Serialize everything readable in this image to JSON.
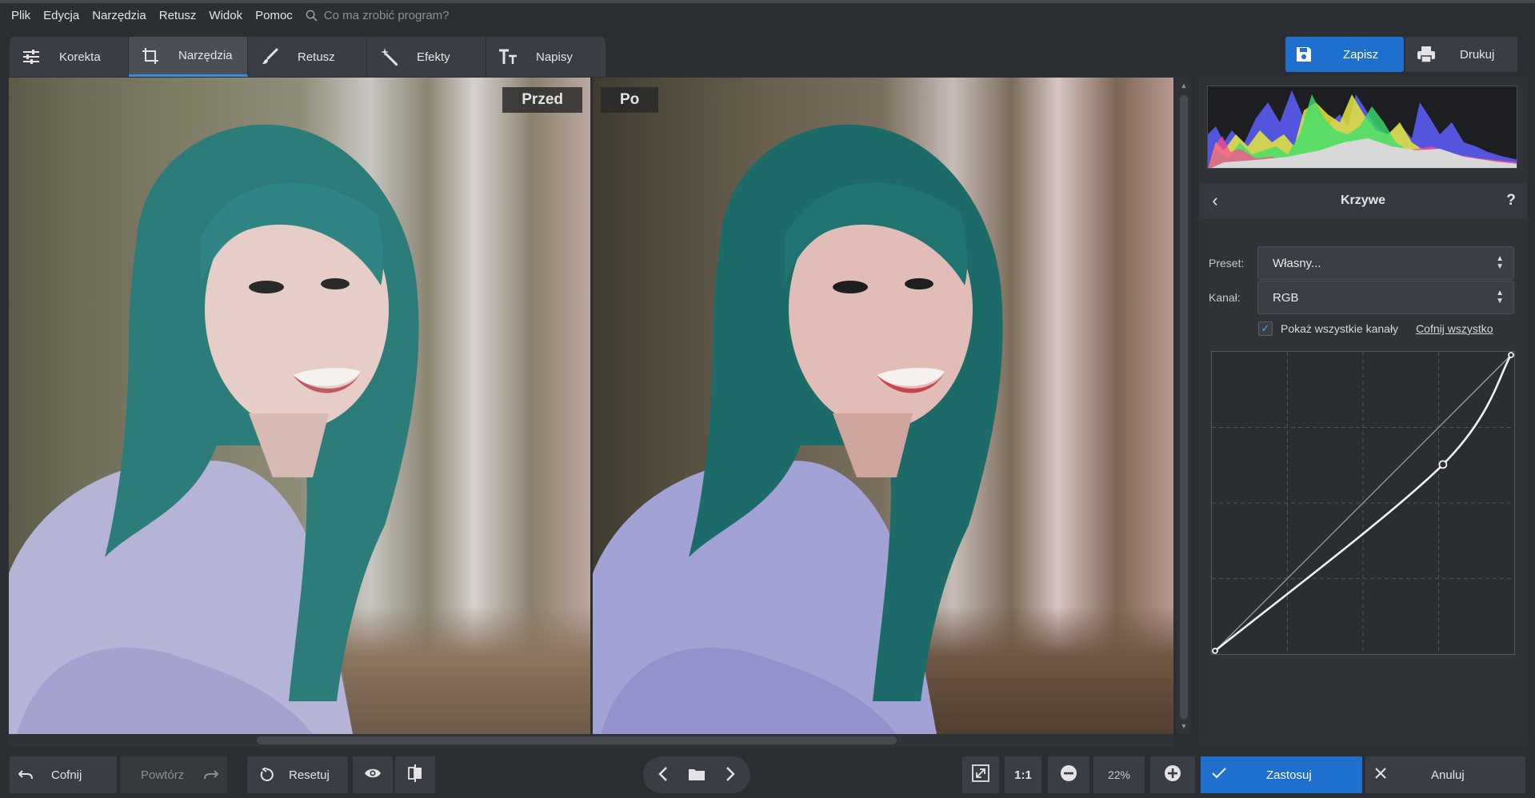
{
  "menu": {
    "items": [
      "Plik",
      "Edycja",
      "Narzędzia",
      "Retusz",
      "Widok",
      "Pomoc"
    ],
    "search_placeholder": "Co ma zrobić program?"
  },
  "tabs": [
    {
      "label": "Korekta",
      "icon": "sliders-icon"
    },
    {
      "label": "Narzędzia",
      "icon": "crop-icon",
      "active": true
    },
    {
      "label": "Retusz",
      "icon": "brush-icon"
    },
    {
      "label": "Efekty",
      "icon": "magic-wand-icon"
    },
    {
      "label": "Napisy",
      "icon": "text-icon"
    }
  ],
  "top_actions": {
    "save_label": "Zapisz",
    "print_label": "Drukuj"
  },
  "preview": {
    "before_label": "Przed",
    "after_label": "Po"
  },
  "panel": {
    "title": "Krzywe",
    "help": "?",
    "preset_label": "Preset:",
    "preset_value": "Własny...",
    "channel_label": "Kanał:",
    "channel_value": "RGB",
    "show_all_channels_label": "Pokaż wszystkie kanały",
    "show_all_channels_checked": true,
    "reset_all_label": "Cofnij wszystko",
    "curve_points": [
      [
        0,
        0
      ],
      [
        0.77,
        0.63
      ],
      [
        1,
        1
      ]
    ]
  },
  "bottom": {
    "undo_label": "Cofnij",
    "redo_label": "Powtórz",
    "reset_label": "Resetuj",
    "one_to_one": "1:1",
    "zoom_value": "22%",
    "apply_label": "Zastosuj",
    "cancel_label": "Anuluj"
  },
  "colors": {
    "accent": "#1f6fce",
    "background": "#2b2e33",
    "panel": "#2f3237"
  }
}
